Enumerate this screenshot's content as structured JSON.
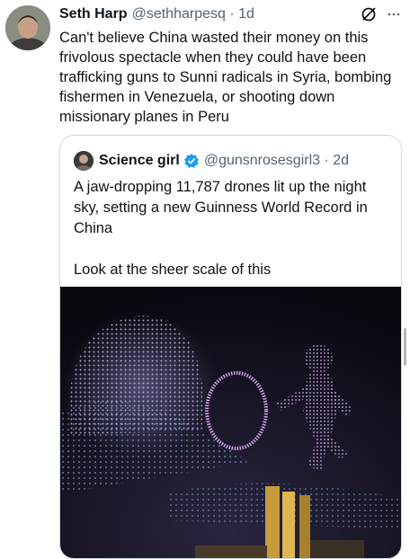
{
  "tweet": {
    "author_name": "Seth Harp",
    "author_handle": "@sethharpesq",
    "time": "1d",
    "text": "Can't believe China wasted their money on this frivolous spectacle when they could have been trafficking guns to Sunni radicals in Syria, bombing fishermen in Venezuela, or shooting down missionary planes in Peru"
  },
  "quote": {
    "author_name": "Science girl",
    "author_handle": "@gunsnrosesgirl3",
    "time": "2d",
    "paragraphs": [
      "A jaw-dropping 11,787 drones lit up the night sky, setting a new Guinness World Record in China",
      "Look at the sheer scale of this"
    ]
  },
  "icons": {
    "grok": "grok-icon",
    "more": "more-icon",
    "verified": "verified-badge-icon"
  },
  "colors": {
    "verified_blue": "#1d9bf0",
    "handle_gray": "#536471"
  }
}
